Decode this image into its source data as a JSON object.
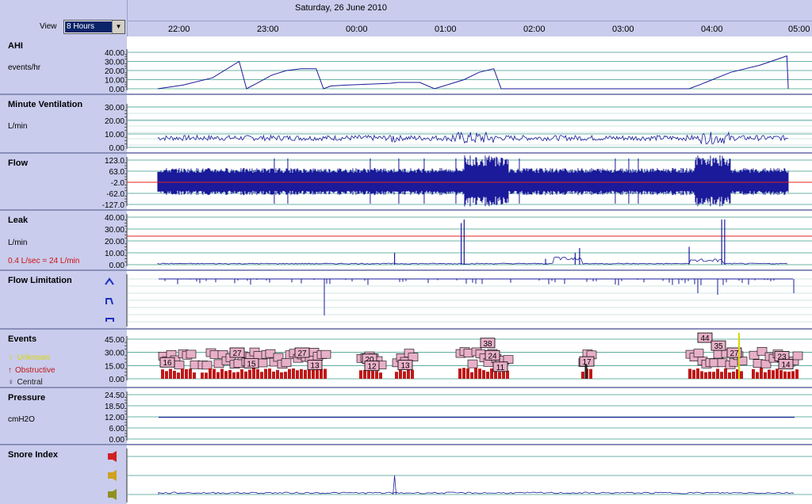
{
  "header": {
    "date": "Saturday, 26 June 2010",
    "view_label": "View",
    "view_value": "8 Hours",
    "times": [
      "22:00",
      "23:00",
      "00:00",
      "01:00",
      "02:00",
      "03:00",
      "04:00",
      "05:00"
    ]
  },
  "panels": {
    "ahi": {
      "title": "AHI",
      "unit": "events/hr"
    },
    "mv": {
      "title": "Minute Ventilation",
      "unit": "L/min"
    },
    "flow": {
      "title": "Flow"
    },
    "leak": {
      "title": "Leak",
      "unit": "L/min",
      "note": "0.4 L/sec = 24 L/min"
    },
    "fl": {
      "title": "Flow Limitation"
    },
    "events": {
      "title": "Events",
      "legend": [
        "Unknown",
        "Obstructive",
        "Central"
      ]
    },
    "pressure": {
      "title": "Pressure",
      "unit": "cmH2O"
    },
    "snore": {
      "title": "Snore Index"
    }
  },
  "colors": {
    "trace": "#1a1a9a",
    "threshold": "#e02020",
    "grid": "#3a9a8a",
    "panel_bg": "#c9ccec",
    "unknown": "#d8d800",
    "obstructive": "#c01818",
    "central": "#202020",
    "event_label": "#e8b0c8"
  },
  "chart_data": [
    {
      "type": "line",
      "name": "AHI",
      "yticks": [
        "40.00",
        "30.00",
        "20.00",
        "10.00",
        "0.00"
      ],
      "ylim": [
        0,
        40
      ],
      "x": [
        "21:53",
        "22:10",
        "22:30",
        "22:48",
        "22:53",
        "23:00",
        "23:10",
        "23:20",
        "23:30",
        "23:40",
        "23:45",
        "23:50",
        "00:00",
        "00:30",
        "00:35",
        "00:50",
        "01:00",
        "01:20",
        "01:30",
        "01:40",
        "01:45",
        "02:00",
        "02:30",
        "03:00",
        "03:30",
        "03:52",
        "04:00",
        "04:20",
        "04:40",
        "04:58",
        "04:59"
      ],
      "y": [
        0,
        4,
        12,
        30,
        0,
        6,
        15,
        20,
        22,
        22,
        0,
        3,
        4,
        6,
        7,
        7,
        0,
        10,
        18,
        22,
        0,
        0,
        0,
        0,
        0,
        0,
        5,
        18,
        26,
        36,
        0
      ]
    },
    {
      "type": "line",
      "name": "Minute Ventilation",
      "yticks": [
        "30.00",
        "20.00",
        "10.00",
        "0.00"
      ],
      "ylim": [
        0,
        30
      ],
      "baseline": 7
    },
    {
      "type": "line",
      "name": "Flow",
      "yticks": [
        "123.0",
        "63.0",
        "-2.0",
        "-62.0",
        "-127.0"
      ],
      "ylim": [
        -127,
        123
      ],
      "threshold": -2
    },
    {
      "type": "line",
      "name": "Leak",
      "yticks": [
        "40.00",
        "30.00",
        "20.00",
        "10.00",
        "0.00"
      ],
      "ylim": [
        0,
        40
      ],
      "threshold": 24,
      "spikes": [
        [
          "00:33",
          10
        ],
        [
          "01:18",
          35
        ],
        [
          "01:20",
          38
        ],
        [
          "02:15",
          5
        ],
        [
          "02:35",
          10
        ],
        [
          "02:38",
          14
        ],
        [
          "03:52",
          15
        ],
        [
          "04:14",
          38
        ],
        [
          "04:16",
          38
        ]
      ]
    },
    {
      "type": "line",
      "name": "Flow Limitation"
    },
    {
      "type": "scatter",
      "name": "Events",
      "yticks": [
        "45.00",
        "30.00",
        "15.00",
        "0.00"
      ],
      "ylim": [
        0,
        45
      ],
      "labels": [
        "16",
        "27",
        "15",
        "27",
        "13",
        "20",
        "12",
        "13",
        "38",
        "24",
        "11",
        "17",
        "44",
        "35",
        "27",
        "23",
        "14"
      ]
    },
    {
      "type": "line",
      "name": "Pressure",
      "yticks": [
        "24.50",
        "18.50",
        "12.00",
        "6.00",
        "0.00"
      ],
      "ylim": [
        0,
        24.5
      ],
      "level": 12
    },
    {
      "type": "line",
      "name": "Snore Index",
      "spike": "00:33"
    }
  ]
}
